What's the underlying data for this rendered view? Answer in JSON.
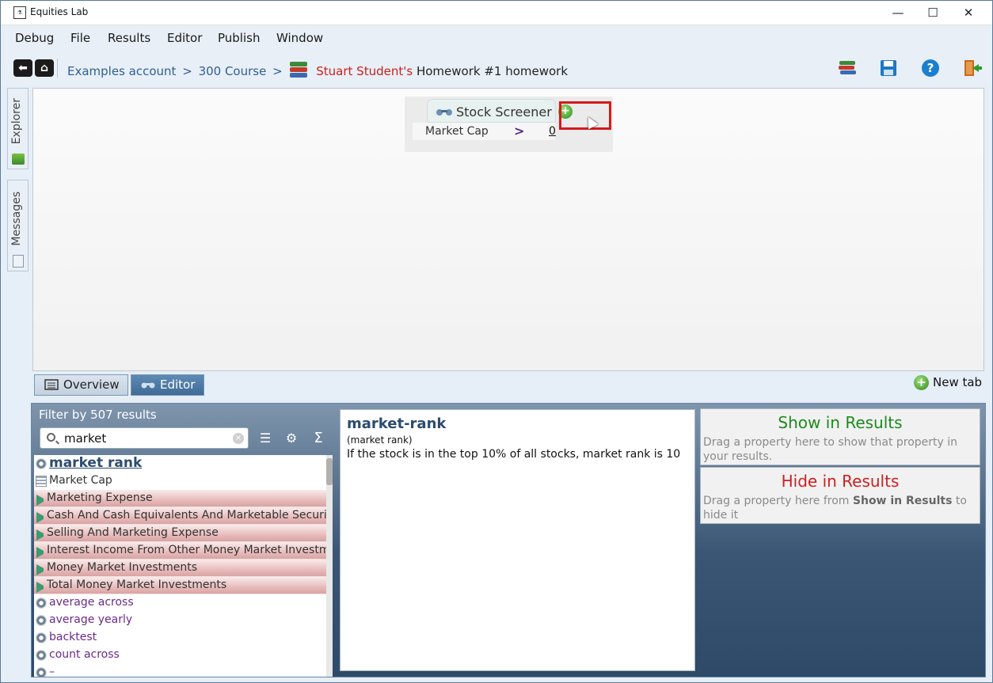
{
  "window": {
    "title": "Equities Lab",
    "app_icon_glyph": "lab",
    "controls": {
      "minimize": "—",
      "maximize": "☐",
      "close": "✕"
    }
  },
  "menu": [
    "Debug",
    "File",
    "Results",
    "Editor",
    "Publish",
    "Window"
  ],
  "breadcrumb": {
    "account": "Examples account",
    "sep": ">",
    "course": "300 Course",
    "owner": "Stuart Student's",
    "document": "Homework #1 homework"
  },
  "toolbar_icons": [
    "library-icon",
    "save-icon",
    "help-icon",
    "exit-icon"
  ],
  "side_tabs": {
    "explorer": "Explorer",
    "messages": "Messages"
  },
  "canvas": {
    "screener_title": "Stock Screener",
    "condition": {
      "field": "Market Cap",
      "operator": ">",
      "value": "0"
    },
    "add_glyph": "+"
  },
  "view_tabs": {
    "overview": "Overview",
    "editor": "Editor",
    "active": "Editor"
  },
  "new_tab": {
    "label": "New tab",
    "glyph": "+"
  },
  "filter": {
    "title": "Filter by 507 results",
    "search_value": "market",
    "clear_glyph": "×",
    "tool_glyphs": {
      "list": "☰",
      "settings": "⚙",
      "sum": "Σ"
    },
    "results": [
      {
        "label": "market rank",
        "kind": "function-link"
      },
      {
        "label": "Market Cap",
        "kind": "table"
      },
      {
        "label": "Marketing Expense",
        "kind": "category"
      },
      {
        "label": "Cash And Cash Equivalents And Marketable Securities",
        "kind": "category"
      },
      {
        "label": "Selling And Marketing Expense",
        "kind": "category"
      },
      {
        "label": "Interest Income From Other Money Market Investments",
        "kind": "category"
      },
      {
        "label": "Money Market Investments",
        "kind": "category"
      },
      {
        "label": "Total Money Market Investments",
        "kind": "category"
      },
      {
        "label": "average across",
        "kind": "function"
      },
      {
        "label": "average yearly",
        "kind": "function"
      },
      {
        "label": "backtest",
        "kind": "function"
      },
      {
        "label": "count across",
        "kind": "function"
      },
      {
        "label": "–",
        "kind": "function"
      }
    ]
  },
  "detail": {
    "title": "market-rank",
    "subtitle": "(market rank)",
    "description": "If the stock is in the top 10% of all stocks, market rank is 10"
  },
  "show_in_results": {
    "title": "Show in Results",
    "description": "Drag a property here to show that property in your results."
  },
  "hide_in_results": {
    "title": "Hide in Results",
    "description_prefix": "Drag a property here from ",
    "description_bold": "Show in Results",
    "description_suffix": " to hide it"
  },
  "colors": {
    "owner_red": "#c8211d",
    "link_blue": "#2f5f93",
    "show_green": "#1c8a1c",
    "hide_red": "#cc2020",
    "highlight_red": "#d41a1a"
  }
}
